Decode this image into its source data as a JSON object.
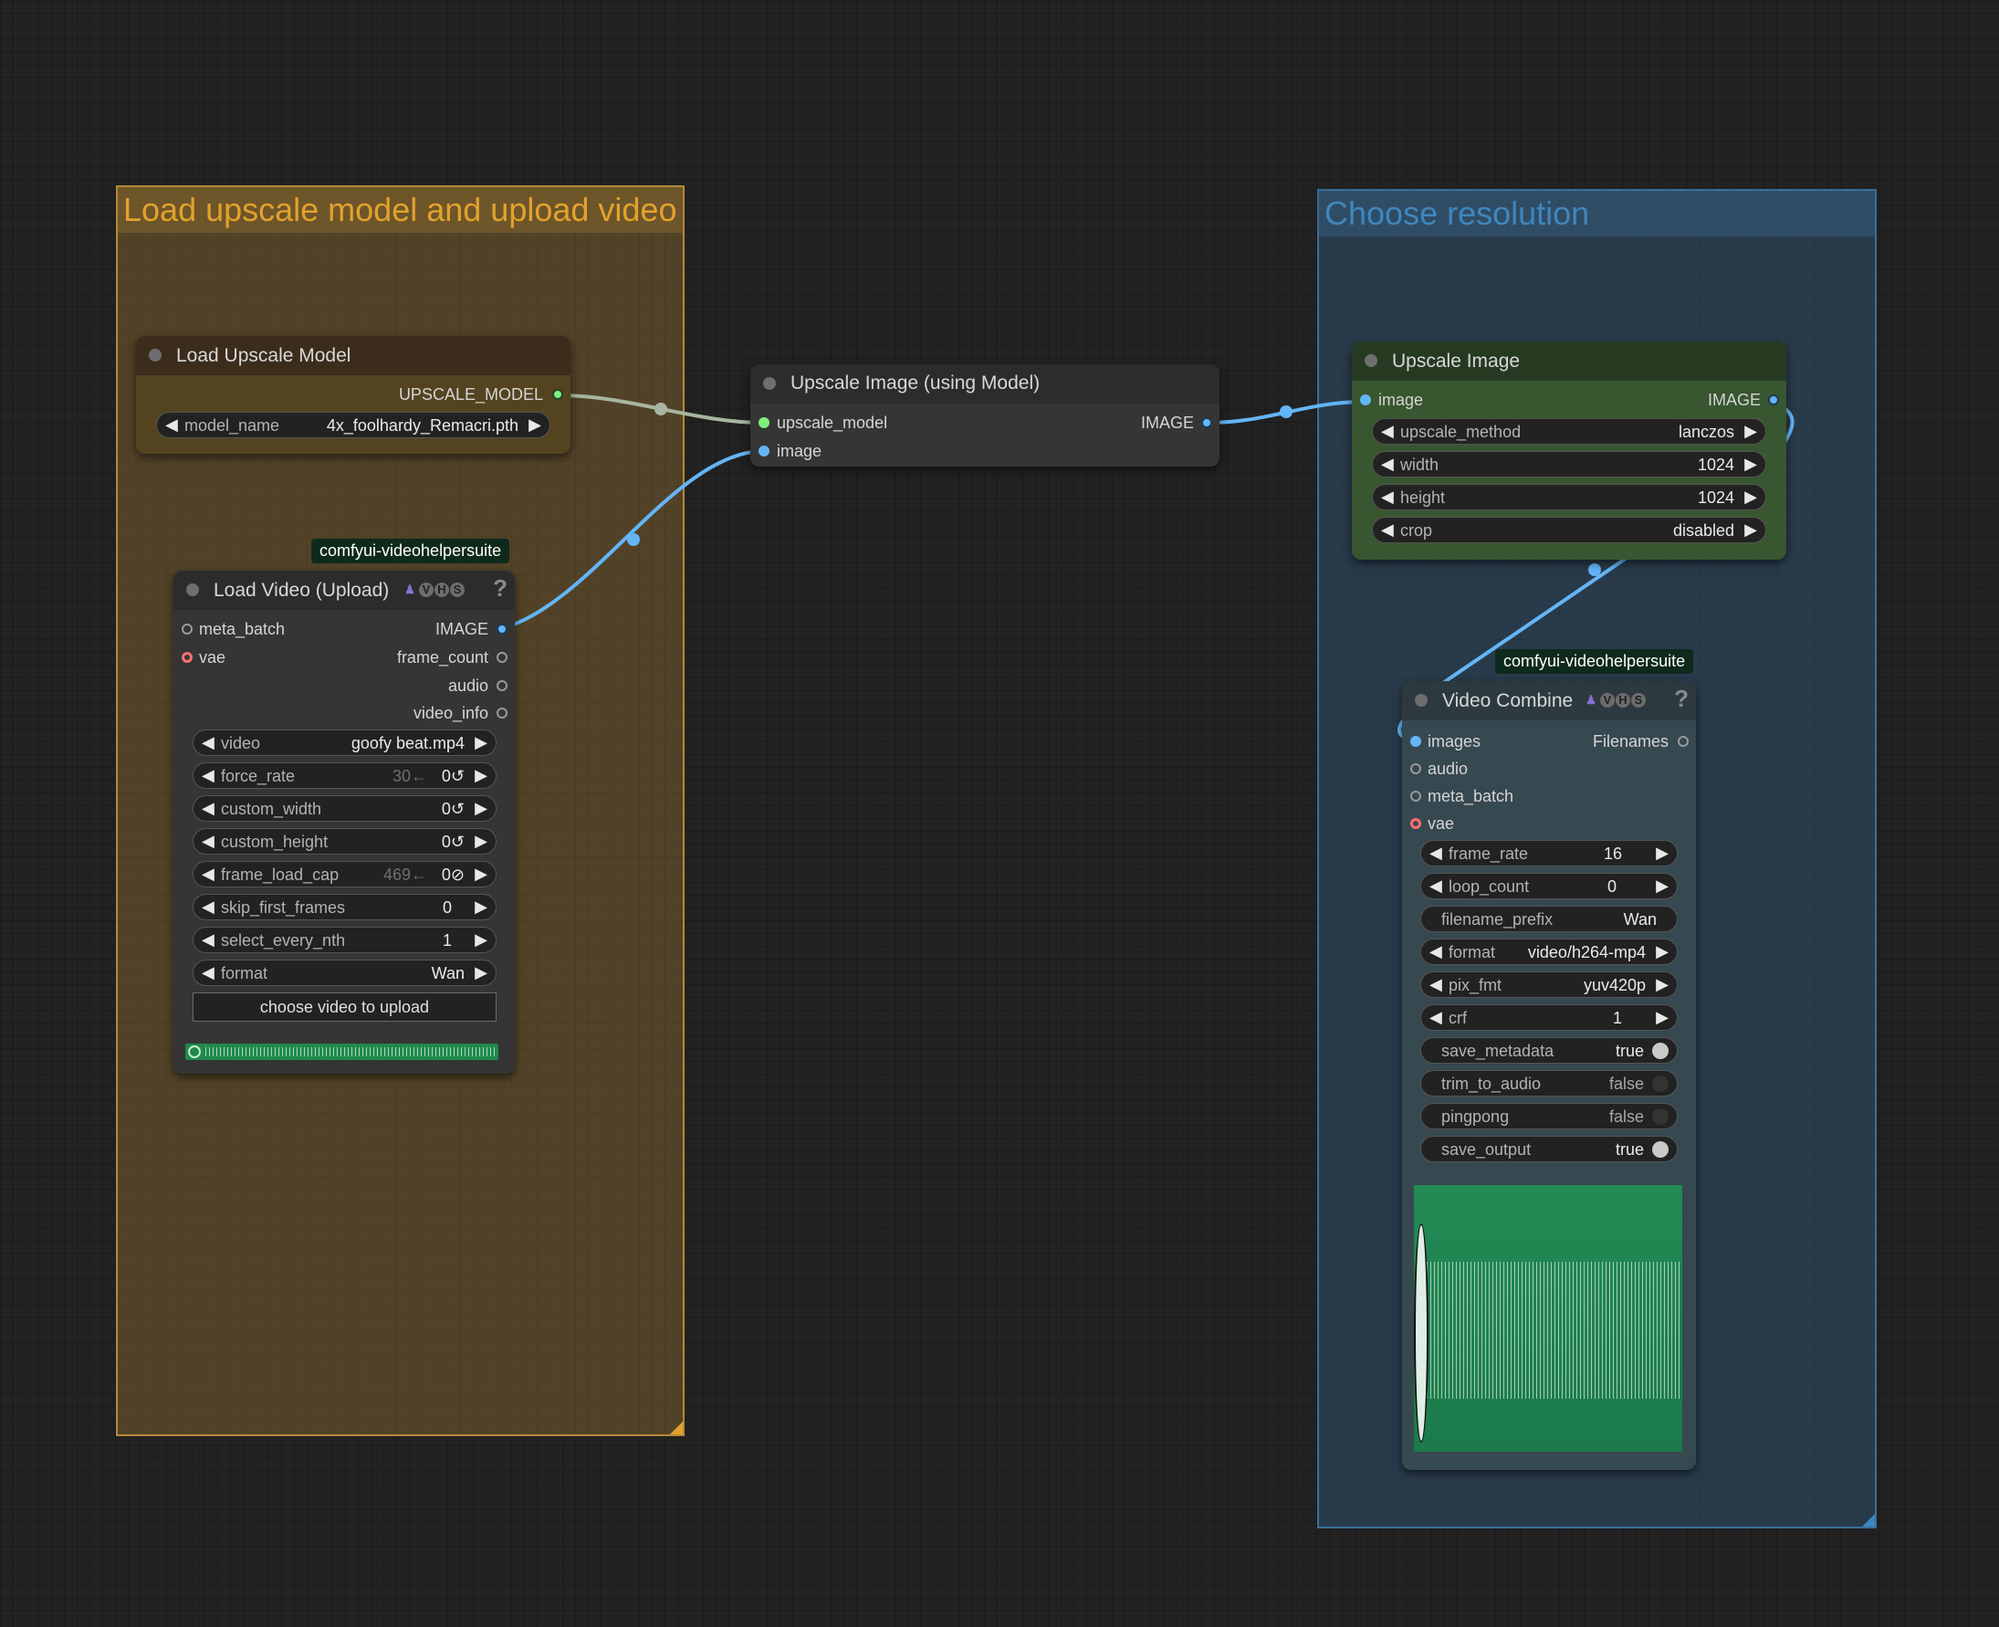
{
  "groups": {
    "load": {
      "title": "Load upscale model and upload video",
      "color": "#e3a22c"
    },
    "resolution": {
      "title": "Choose resolution",
      "color": "#3f86bd"
    }
  },
  "nodes": {
    "load_upscale_model": {
      "title": "Load Upscale Model",
      "output": "UPSCALE_MODEL",
      "model_name": {
        "label": "model_name",
        "value": "4x_foolhardy_Remacri.pth"
      }
    },
    "upscale_using_model": {
      "title": "Upscale Image (using Model)",
      "inputs": [
        "upscale_model",
        "image"
      ],
      "output": "IMAGE"
    },
    "upscale_image": {
      "title": "Upscale Image",
      "input": "image",
      "output": "IMAGE",
      "widgets": [
        {
          "label": "upscale_method",
          "value": "lanczos"
        },
        {
          "label": "width",
          "value": "1024"
        },
        {
          "label": "height",
          "value": "1024"
        },
        {
          "label": "crop",
          "value": "disabled"
        }
      ]
    },
    "load_video": {
      "badge": "comfyui-videohelpersuite",
      "title": "Load Video (Upload)",
      "icon_letters": [
        "V",
        "H",
        "S"
      ],
      "help": "?",
      "inputs": [
        "meta_batch",
        "vae"
      ],
      "outputs": [
        "IMAGE",
        "frame_count",
        "audio",
        "video_info"
      ],
      "widgets": [
        {
          "label": "video",
          "value": "goofy beat.mp4",
          "hint": ""
        },
        {
          "label": "force_rate",
          "value": "0↺",
          "hint": "30←"
        },
        {
          "label": "custom_width",
          "value": "0↺",
          "hint": ""
        },
        {
          "label": "custom_height",
          "value": "0↺",
          "hint": ""
        },
        {
          "label": "frame_load_cap",
          "value": "0⊘",
          "hint": "469←"
        },
        {
          "label": "skip_first_frames",
          "value": "0",
          "hint": ""
        },
        {
          "label": "select_every_nth",
          "value": "1",
          "hint": ""
        },
        {
          "label": "format",
          "value": "Wan",
          "hint": ""
        }
      ],
      "upload_button": "choose video to upload"
    },
    "video_combine": {
      "badge": "comfyui-videohelpersuite",
      "title": "Video Combine",
      "icon_letters": [
        "V",
        "H",
        "S"
      ],
      "help": "?",
      "inputs": [
        "images",
        "audio",
        "meta_batch",
        "vae"
      ],
      "output": "Filenames",
      "widgets": [
        {
          "label": "frame_rate",
          "value": "16"
        },
        {
          "label": "loop_count",
          "value": "0"
        },
        {
          "label": "filename_prefix",
          "value": "Wan"
        },
        {
          "label": "format",
          "value": "video/h264-mp4"
        },
        {
          "label": "pix_fmt",
          "value": "yuv420p"
        },
        {
          "label": "crf",
          "value": "1"
        }
      ],
      "toggles": [
        {
          "label": "save_metadata",
          "value": "true"
        },
        {
          "label": "trim_to_audio",
          "value": "false"
        },
        {
          "label": "pingpong",
          "value": "false"
        },
        {
          "label": "save_output",
          "value": "true"
        }
      ]
    }
  },
  "colors": {
    "image_wire": "#64b5f6",
    "model_wire": "#a8b5a0",
    "preview_green": "#1e8a52",
    "upscale_header": "#263a22",
    "upscale_body": "#38562f",
    "model_header": "#3b2c1c",
    "model_body": "#54431f"
  }
}
